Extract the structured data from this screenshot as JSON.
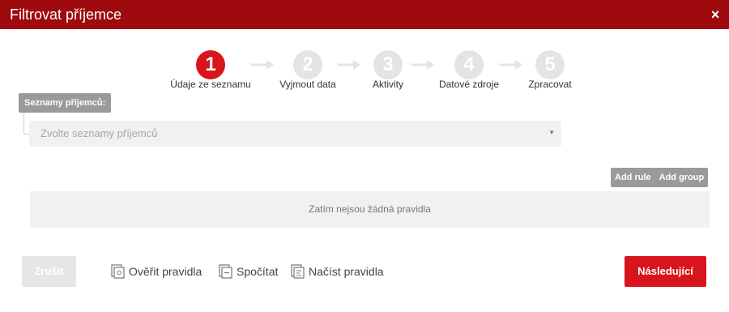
{
  "dialog": {
    "title": "Filtrovat příjemce",
    "close_icon": "close-icon",
    "close_glyph": "×"
  },
  "colors": {
    "header": "#9e0a0e",
    "accent": "#d8151c",
    "inactive_step": "#e4e4e4",
    "tag_gray": "#9a9a9a"
  },
  "steps": [
    {
      "number": "1",
      "label": "Údaje ze seznamu",
      "active": true
    },
    {
      "number": "2",
      "label": "Vyjmout data",
      "active": false
    },
    {
      "number": "3",
      "label": "Aktivity",
      "active": false
    },
    {
      "number": "4",
      "label": "Datové zdroje",
      "active": false
    },
    {
      "number": "5",
      "label": "Zpracovat",
      "active": false
    }
  ],
  "recipient_lists": {
    "label": "Seznamy příjemců:",
    "placeholder": "Zvolte seznamy příjemců",
    "caret_glyph": "▼"
  },
  "rules": {
    "add_rule": "Add rule",
    "add_group": "Add group",
    "empty_text": "Zatím nejsou žádná pravidla"
  },
  "footer": {
    "cancel": "Zrušit",
    "verify": "Ověřit pravidla",
    "count": "Spočítat",
    "load": "Načíst pravidla",
    "next": "Následující"
  }
}
